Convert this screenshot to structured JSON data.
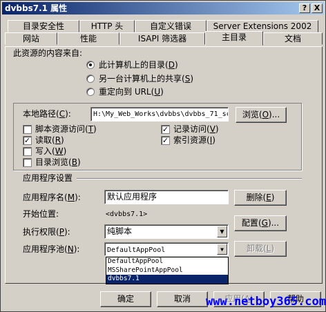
{
  "window": {
    "title": "dvbbs7.1 属性",
    "help_btn": "?",
    "close_btn": "X"
  },
  "tabs_row1": [
    "目录安全性",
    "HTTP 头",
    "自定义错误",
    "Server Extensions 2002"
  ],
  "tabs_row2": [
    "网站",
    "性能",
    "ISAPI 筛选器",
    "主目录",
    "文档"
  ],
  "content_source": {
    "label": "此资源的内容来自:",
    "options": [
      {
        "text": "此计算机上的目录",
        "key": "D",
        "selected": true
      },
      {
        "text": "另一台计算机上的共享",
        "key": "S",
        "selected": false
      },
      {
        "text": "重定向到 URL",
        "key": "U",
        "selected": false
      }
    ]
  },
  "local_path": {
    "label": "本地路径",
    "key": "C",
    "value": "H:\\My_Web_Works\\dvbbs\\dvbbs_71_sc",
    "browse": "浏览",
    "browse_key": "O"
  },
  "checkboxes": [
    {
      "text": "脚本资源访问",
      "key": "T",
      "checked": false
    },
    {
      "text": "读取",
      "key": "R",
      "checked": true
    },
    {
      "text": "写入",
      "key": "W",
      "checked": false
    },
    {
      "text": "目录浏览",
      "key": "B",
      "checked": false
    },
    {
      "text": "记录访问",
      "key": "V",
      "checked": true
    },
    {
      "text": "索引资源",
      "key": "I",
      "checked": true
    }
  ],
  "app_settings": {
    "header": "应用程序设置",
    "name_label": "应用程序名",
    "name_key": "M",
    "name_value": "默认应用程序",
    "remove": "删除",
    "remove_key": "E",
    "start_label": "开始位置:",
    "start_value": "<dvbbs7.1>",
    "config": "配置",
    "config_key": "G",
    "perm_label": "执行权限",
    "perm_key": "P",
    "perm_value": "纯脚本",
    "pool_label": "应用程序池",
    "pool_key": "N",
    "pool_value": "DefaultAppPool",
    "unload": "卸载",
    "unload_key": "L",
    "pool_options": [
      "DefaultAppPool",
      "MSSharePointAppPool",
      "dvbbs7.1"
    ]
  },
  "footer": {
    "ok": "确定",
    "cancel": "取消",
    "apply": "应用",
    "apply_key": "A",
    "help": "帮助"
  },
  "watermark": "www.netboy365.com"
}
